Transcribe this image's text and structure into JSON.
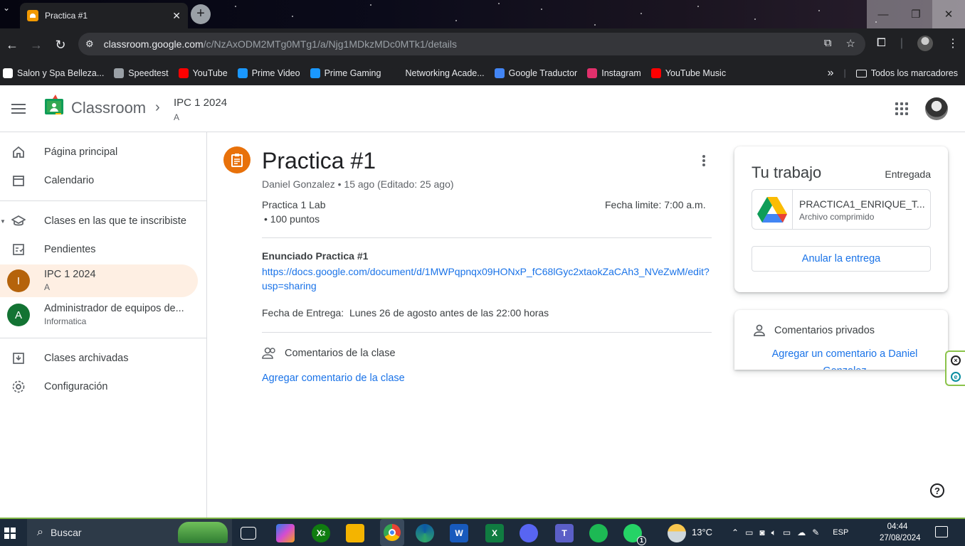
{
  "browser": {
    "tab_title": "Practica #1",
    "new_tab": "+",
    "close_tab": "✕",
    "url_host": "classroom.google.com",
    "url_path": "/c/NzAxODM2MTg0MTg1/a/Njg1MDkzMDc0MTk1/details",
    "bookmarks": [
      {
        "label": "Salon y Spa Belleza...",
        "color": "#ffffff"
      },
      {
        "label": "Speedtest",
        "color": "#9aa0a6"
      },
      {
        "label": "YouTube",
        "color": "#ff0000"
      },
      {
        "label": "Prime Video",
        "color": "#1a98ff"
      },
      {
        "label": "Prime Gaming",
        "color": "#1a98ff"
      },
      {
        "label": "Networking Acade...",
        "color": "#202124"
      },
      {
        "label": "Google Traductor",
        "color": "#4285f4"
      },
      {
        "label": "Instagram",
        "color": "#e1306c"
      },
      {
        "label": "YouTube Music",
        "color": "#ff0000"
      }
    ],
    "bookmarks_overflow": "»",
    "all_bookmarks": "Todos los marcadores"
  },
  "header": {
    "app_name": "Classroom",
    "class_name": "IPC 1 2024",
    "section": "A"
  },
  "sidebar": {
    "home": "Página principal",
    "calendar": "Calendario",
    "enrolled": "Clases en las que te inscribiste",
    "todo": "Pendientes",
    "classes": [
      {
        "initial": "I",
        "name": "IPC 1 2024",
        "sub": "A",
        "color": "#b5630b"
      },
      {
        "initial": "A",
        "name": "Administrador de equipos de...",
        "sub": "Informatica",
        "color": "#137333"
      }
    ],
    "archived": "Clases archivadas",
    "settings": "Configuración"
  },
  "assignment": {
    "title": "Practica #1",
    "meta": "Daniel Gonzalez • 15 ago (Editado: 25 ago)",
    "topic": "Practica 1 Lab",
    "points": "• 100 puntos",
    "due": "Fecha limite: 7:00 a.m.",
    "desc_heading": "Enunciado Practica #1",
    "desc_link": "https://docs.google.com/document/d/1MWPqpnqx09HONxP_fC68lGyc2xtaokZaCAh3_NVeZwM/edit?usp=sharing",
    "desc_date": "Fecha de Entrega:  Lunes 26 de agosto antes de las 22:00 horas",
    "class_comments": "Comentarios de la clase",
    "add_class_comment": "Agregar comentario de la clase"
  },
  "work": {
    "title": "Tu trabajo",
    "status": "Entregada",
    "file_name": "PRACTICA1_ENRIQUE_T...",
    "file_type": "Archivo comprimido",
    "unsubmit": "Anular la entrega"
  },
  "private_comments": {
    "title": "Comentarios privados",
    "add": "Agregar un comentario a Daniel Gonzalez"
  },
  "taskbar": {
    "search": "Buscar",
    "weather": "13°C",
    "lang": "ESP",
    "time": "04:44",
    "date": "27/08/2024",
    "whatsapp_badge": "1",
    "xbox_badge": "2"
  },
  "colors": {
    "accent": "#1a73e8",
    "assignment": "#e8710a",
    "selected_bg": "#feefe3"
  }
}
